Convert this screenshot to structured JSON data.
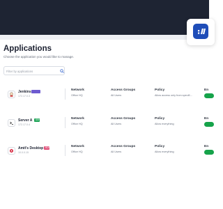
{
  "colors": {
    "topbar": "#1e2433",
    "brand": "#1f4db8",
    "toggle_on": "#16a34a",
    "tag_purple": "#6d5bd0",
    "tag_green": "#22a65a",
    "tag_pink": "#e0527a"
  },
  "header": {
    "app_icon": "brand-logo-icon"
  },
  "page": {
    "title": "Applications",
    "subtitle": "Choose the application you would like to manage."
  },
  "search": {
    "placeholder": "Filter by applications",
    "value": ""
  },
  "columns": {
    "network": "Network",
    "access_groups": "Access Groups",
    "policy": "Policy",
    "enabled": "En"
  },
  "apps": [
    {
      "name": "Jenkins",
      "tag": "",
      "tag_color": "#6d5bd0",
      "ip": "172.17.0.3",
      "icon": "jenkins-icon",
      "network": "Office HQ",
      "access_groups": "All Users",
      "policy": "Allow access only from specifi…",
      "enabled": true
    },
    {
      "name": "Server A",
      "tag": "SSH",
      "tag_color": "#22a65a",
      "ip": "172.17.0.4",
      "icon": "terminal-icon",
      "network": "Office HQ",
      "access_groups": "All Users",
      "policy": "Allow everything",
      "enabled": true
    },
    {
      "name": "Amit's Desktop",
      "tag": "RDP",
      "tag_color": "#e0527a",
      "ip": "10.0.0.15",
      "icon": "desktop-icon",
      "network": "Office HQ",
      "access_groups": "All Users",
      "policy": "Allow everything",
      "enabled": true
    }
  ]
}
